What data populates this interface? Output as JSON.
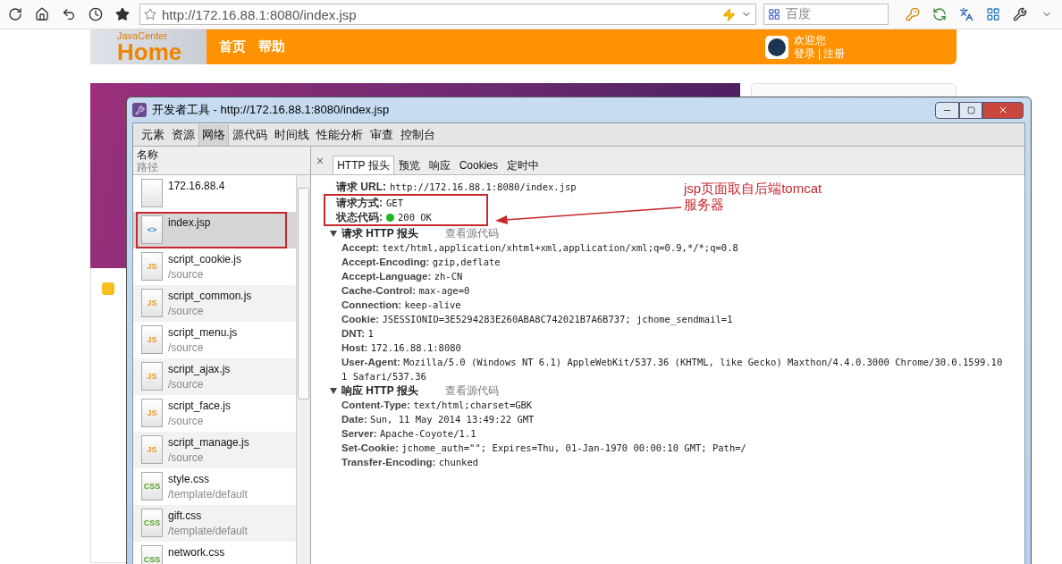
{
  "browser": {
    "address": "http://172.16.88.1:8080/index.jsp",
    "search_placeholder": "百度"
  },
  "site_header": {
    "logo_small": "JavaCenter",
    "logo_large": "Home",
    "nav": [
      "首页",
      "帮助"
    ],
    "welcome": "欢迎您",
    "login": "登录",
    "separator": "|",
    "register": "注册"
  },
  "devtools": {
    "title": "开发者工具 - http://172.16.88.1:8080/index.jsp",
    "tabs": [
      {
        "label": "元素",
        "selected": false
      },
      {
        "label": "资源",
        "selected": false
      },
      {
        "label": "网络",
        "selected": true
      },
      {
        "label": "源代码",
        "selected": false
      },
      {
        "label": "时间线",
        "selected": false
      },
      {
        "label": "性能分析",
        "selected": false
      },
      {
        "label": "审查",
        "selected": false
      },
      {
        "label": "控制台",
        "selected": false
      }
    ],
    "list_header": {
      "name": "名称",
      "path": "路径"
    },
    "requests": [
      {
        "name": "172.16.88.4",
        "kind": "blank",
        "selected": false
      },
      {
        "name": "index.jsp",
        "kind": "document",
        "icon_label": "<>",
        "selected": true
      },
      {
        "name": "script_cookie.js",
        "path": "/source",
        "kind": "js",
        "icon_label": "JS",
        "selected": false
      },
      {
        "name": "script_common.js",
        "path": "/source",
        "kind": "js",
        "icon_label": "JS",
        "selected": false
      },
      {
        "name": "script_menu.js",
        "path": "/source",
        "kind": "js",
        "icon_label": "JS",
        "selected": false
      },
      {
        "name": "script_ajax.js",
        "path": "/source",
        "kind": "js",
        "icon_label": "JS",
        "selected": false
      },
      {
        "name": "script_face.js",
        "path": "/source",
        "kind": "js",
        "icon_label": "JS",
        "selected": false
      },
      {
        "name": "script_manage.js",
        "path": "/source",
        "kind": "js",
        "icon_label": "JS",
        "selected": false
      },
      {
        "name": "style.css",
        "path": "/template/default",
        "kind": "css",
        "icon_label": "CSS",
        "selected": false
      },
      {
        "name": "gift.css",
        "path": "/template/default",
        "kind": "css",
        "icon_label": "CSS",
        "selected": false
      },
      {
        "name": "network.css",
        "kind": "css",
        "icon_label": "CSS",
        "selected": false
      }
    ],
    "close_symbol": "×",
    "detail_tabs": [
      {
        "label": "HTTP 报头",
        "selected": true
      },
      {
        "label": "预览",
        "selected": false
      },
      {
        "label": "响应",
        "selected": false
      },
      {
        "label": "Cookies",
        "selected": false
      },
      {
        "label": "定时中",
        "selected": false
      }
    ],
    "general": [
      {
        "label": "请求 URL:",
        "value": "http://172.16.88.1:8080/index.jsp",
        "kind": "text"
      },
      {
        "label": "请求方式:",
        "value": "GET",
        "kind": "text"
      },
      {
        "label": "状态代码:",
        "value": "200 OK",
        "kind": "status",
        "color": "#22b422"
      }
    ],
    "sections": [
      {
        "title": "请求 HTTP 报头",
        "expanded": true,
        "link": "查看源代码",
        "headers": [
          {
            "name": "Accept:",
            "value": "text/html,application/xhtml+xml,application/xml;q=0.9,*/*;q=0.8"
          },
          {
            "name": "Accept-Encoding:",
            "value": "gzip,deflate"
          },
          {
            "name": "Accept-Language:",
            "value": "zh-CN"
          },
          {
            "name": "Cache-Control:",
            "value": "max-age=0"
          },
          {
            "name": "Connection:",
            "value": "keep-alive"
          },
          {
            "name": "Cookie:",
            "value": "JSESSIONID=3E5294283E260ABA8C742021B7A6B737; jchome_sendmail=1"
          },
          {
            "name": "DNT:",
            "value": "1"
          },
          {
            "name": "Host:",
            "value": "172.16.88.1:8080"
          },
          {
            "name": "User-Agent:",
            "value": "Mozilla/5.0 (Windows NT 6.1) AppleWebKit/537.36 (KHTML, like Gecko) Maxthon/4.4.0.3000 Chrome/30.0.1599.101 Safari/537.36"
          }
        ]
      },
      {
        "title": "响应 HTTP 报头",
        "expanded": true,
        "link": "查看源代码",
        "headers": [
          {
            "name": "Content-Type:",
            "value": "text/html;charset=GBK"
          },
          {
            "name": "Date:",
            "value": "Sun, 11 May 2014 13:49:22 GMT"
          },
          {
            "name": "Server:",
            "value": "Apache-Coyote/1.1"
          },
          {
            "name": "Set-Cookie:",
            "value": "jchome_auth=\"\"; Expires=Thu, 01-Jan-1970 00:00:10 GMT; Path=/"
          },
          {
            "name": "Transfer-Encoding:",
            "value": "chunked"
          }
        ]
      }
    ]
  },
  "annotation": {
    "note": "jsp页面取自后端tomcat\n服务器"
  }
}
